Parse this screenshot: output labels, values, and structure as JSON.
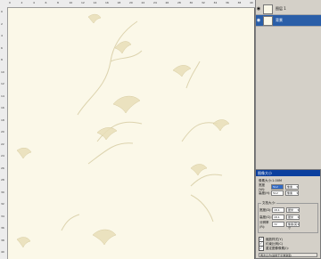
{
  "ruler": {
    "labels": [
      "0",
      "2",
      "4",
      "6",
      "8",
      "10",
      "12",
      "14",
      "16",
      "18",
      "20",
      "22",
      "24",
      "26",
      "28",
      "30",
      "32",
      "34",
      "36",
      "38",
      "40"
    ]
  },
  "layers": [
    {
      "name": "图层 1",
      "visible": true,
      "selected": false
    },
    {
      "name": "背景",
      "visible": true,
      "selected": true
    }
  ],
  "dialog": {
    "title": "图像大小",
    "pixel_dimensions": "像素大小:1.00M",
    "width_label": "宽度(W):",
    "width_value": "512",
    "height_label": "高度(H):",
    "height_value": "512",
    "pixels_unit": "像素",
    "doc_size_title": "文档大小:",
    "doc_width_label": "宽度(D):",
    "doc_width_value": "18.1",
    "doc_height_label": "高度(G):",
    "doc_height_value": "18.1",
    "resolution_label": "分辨率(R):",
    "resolution_value": "72",
    "cm_unit": "厘米",
    "res_unit": "像素/英寸",
    "scale_styles": "缩放样式(Y)",
    "constrain": "约束比例(C)",
    "resample": "重定图像像素(I):",
    "resample_method": "两次立方(适用于平滑渐变)"
  }
}
